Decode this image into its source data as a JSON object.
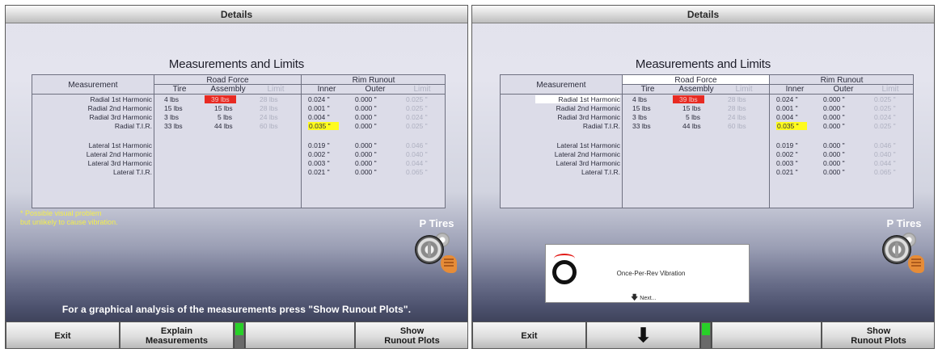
{
  "screens": [
    {
      "title": "Details",
      "heading": "Measurements and Limits",
      "table": {
        "measurement_header": "Measurement",
        "road_force_header": "Road Force",
        "rim_runout_header": "Rim Runout",
        "sub_tire": "Tire",
        "sub_assembly": "Assembly",
        "sub_limit": "Limit",
        "sub_inner": "Inner",
        "sub_outer": "Outer",
        "sub_limit2": "Limit",
        "radial_rows": [
          {
            "label": "Radial 1st Harmonic",
            "tire": "4 lbs",
            "assembly": "39 lbs",
            "limit": "28 lbs",
            "inner": "0.024 \"",
            "outer": "0.000 \"",
            "limit2": "0.025 \""
          },
          {
            "label": "Radial 2nd Harmonic",
            "tire": "15 lbs",
            "assembly": "15 lbs",
            "limit": "28 lbs",
            "inner": "0.001 \"",
            "outer": "0.000 \"",
            "limit2": "0.025 \""
          },
          {
            "label": "Radial 3rd Harmonic",
            "tire": "3 lbs",
            "assembly": "5 lbs",
            "limit": "24 lbs",
            "inner": "0.004 \"",
            "outer": "0.000 \"",
            "limit2": "0.024 \""
          },
          {
            "label": "Radial T.I.R.",
            "tire": "33 lbs",
            "assembly": "44 lbs",
            "limit": "60 lbs",
            "inner": "0.035 \"",
            "outer": "0.000 \"",
            "limit2": "0.025 \""
          }
        ],
        "lateral_rows": [
          {
            "label": "Lateral 1st Harmonic",
            "inner": "0.019 \"",
            "outer": "0.000 \"",
            "limit2": "0.046 \""
          },
          {
            "label": "Lateral 2nd Harmonic",
            "inner": "0.002 \"",
            "outer": "0.000 \"",
            "limit2": "0.040 \""
          },
          {
            "label": "Lateral 3rd Harmonic",
            "inner": "0.003 \"",
            "outer": "0.000 \"",
            "limit2": "0.044 \""
          },
          {
            "label": "Lateral T.I.R.",
            "inner": "0.021 \"",
            "outer": "0.000 \"",
            "limit2": "0.065 \""
          }
        ]
      },
      "note_line1": "* Possible visual problem",
      "note_line2": "but unlikely to cause vibration.",
      "tires_label": "P Tires",
      "help_text": "For a graphical analysis of the measurements press \"Show Runout Plots\".",
      "buttons": {
        "b1": "Exit",
        "b2_line1": "Explain",
        "b2_line2": "Measurements",
        "b3": "",
        "b4_line1": "Show",
        "b4_line2": "Runout Plots"
      }
    },
    {
      "title": "Details",
      "heading": "Measurements and Limits",
      "table": {
        "measurement_header": "Measurement",
        "road_force_header": "Road Force",
        "rim_runout_header": "Rim Runout",
        "sub_tire": "Tire",
        "sub_assembly": "Assembly",
        "sub_limit": "Limit",
        "sub_inner": "Inner",
        "sub_outer": "Outer",
        "sub_limit2": "Limit",
        "radial_rows": [
          {
            "label": "Radial 1st Harmonic",
            "tire": "4 lbs",
            "assembly": "39 lbs",
            "limit": "28 lbs",
            "inner": "0.024 \"",
            "outer": "0.000 \"",
            "limit2": "0.025 \""
          },
          {
            "label": "Radial 2nd Harmonic",
            "tire": "15 lbs",
            "assembly": "15 lbs",
            "limit": "28 lbs",
            "inner": "0.001 \"",
            "outer": "0.000 \"",
            "limit2": "0.025 \""
          },
          {
            "label": "Radial 3rd Harmonic",
            "tire": "3 lbs",
            "assembly": "5 lbs",
            "limit": "24 lbs",
            "inner": "0.004 \"",
            "outer": "0.000 \"",
            "limit2": "0.024 \""
          },
          {
            "label": "Radial T.I.R.",
            "tire": "33 lbs",
            "assembly": "44 lbs",
            "limit": "60 lbs",
            "inner": "0.035 \"",
            "outer": "0.000 \"",
            "limit2": "0.025 \""
          }
        ],
        "lateral_rows": [
          {
            "label": "Lateral 1st Harmonic",
            "inner": "0.019 \"",
            "outer": "0.000 \"",
            "limit2": "0.046 \""
          },
          {
            "label": "Lateral 2nd Harmonic",
            "inner": "0.002 \"",
            "outer": "0.000 \"",
            "limit2": "0.040 \""
          },
          {
            "label": "Lateral 3rd Harmonic",
            "inner": "0.003 \"",
            "outer": "0.000 \"",
            "limit2": "0.044 \""
          },
          {
            "label": "Lateral T.I.R.",
            "inner": "0.021 \"",
            "outer": "0.000 \"",
            "limit2": "0.065 \""
          }
        ]
      },
      "tires_label": "P Tires",
      "popup": {
        "text": "Once-Per-Rev Vibration",
        "next": "Next..."
      },
      "buttons": {
        "b1": "Exit",
        "b2_icon": "down-arrow-icon",
        "b3": "",
        "b4_line1": "Show",
        "b4_line2": "Runout Plots"
      }
    }
  ],
  "colors": {
    "fail_highlight": "#e82a22",
    "warning_highlight": "#fffb1e",
    "indicator": "#28d028",
    "note_text": "#f4ee4c"
  }
}
